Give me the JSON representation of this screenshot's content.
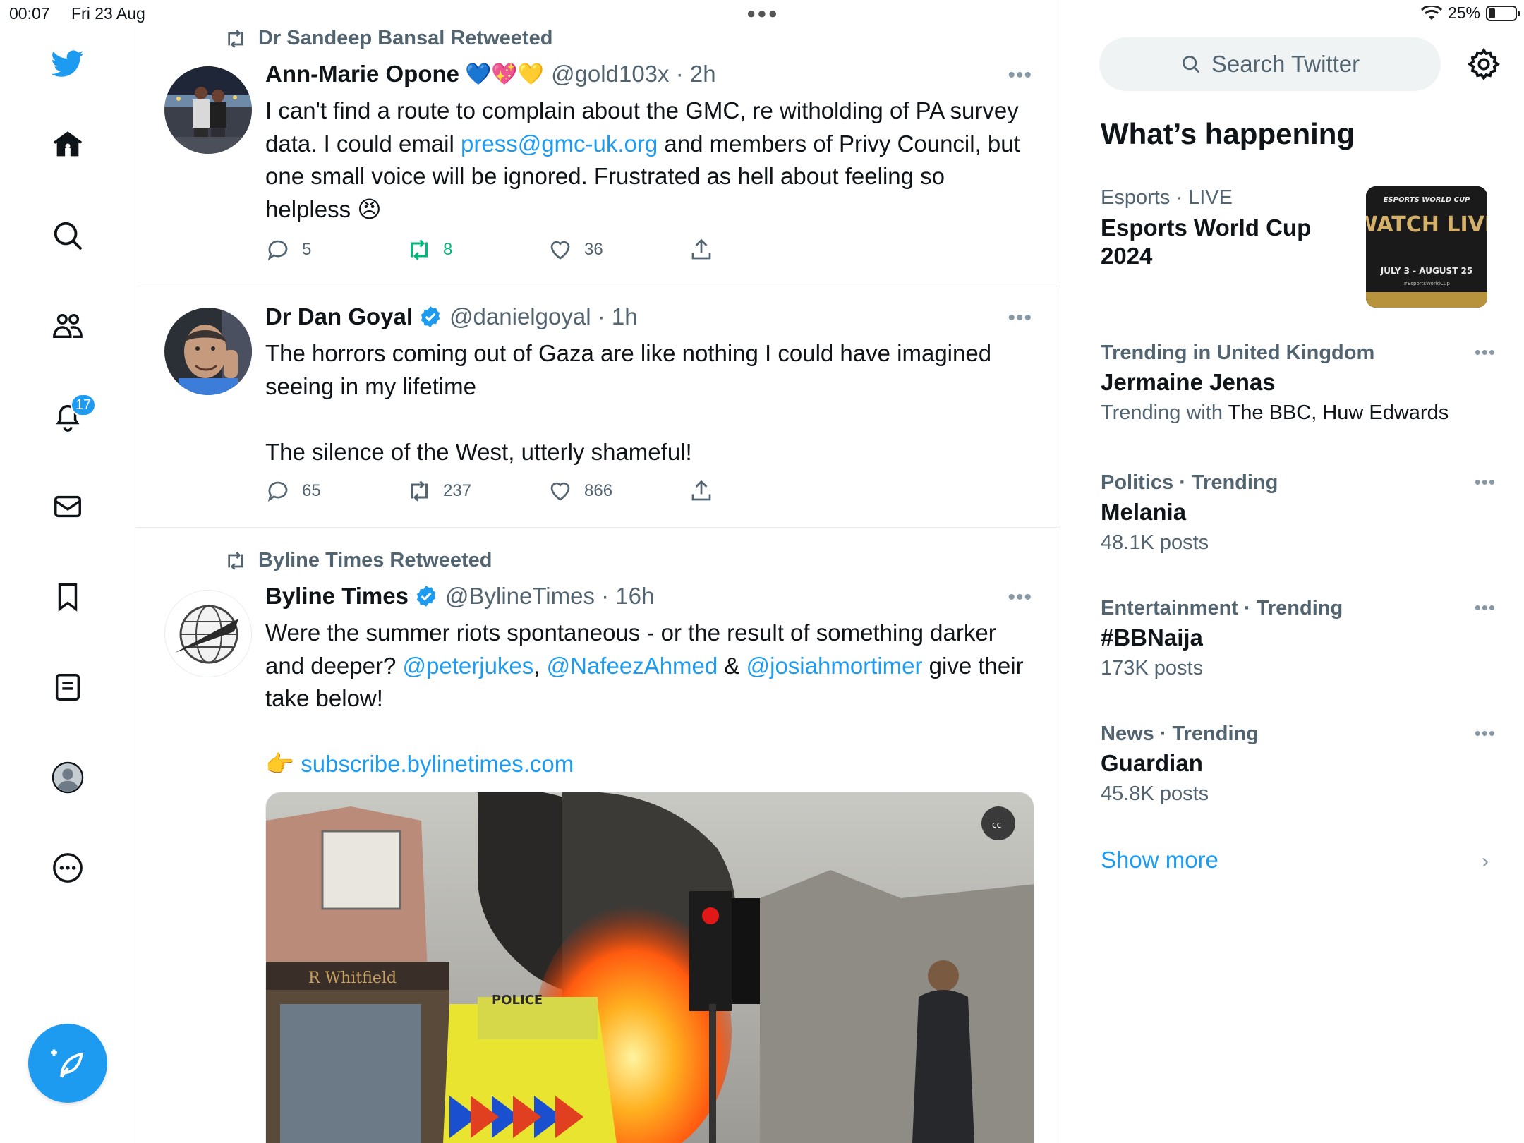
{
  "status_bar": {
    "time": "00:07",
    "date": "Fri 23 Aug",
    "battery": "25%"
  },
  "sidebar": {
    "items": [
      {
        "name": "home"
      },
      {
        "name": "explore"
      },
      {
        "name": "communities"
      },
      {
        "name": "notifications",
        "badge": "17"
      },
      {
        "name": "messages"
      },
      {
        "name": "bookmarks"
      },
      {
        "name": "lists"
      },
      {
        "name": "profile"
      },
      {
        "name": "more"
      }
    ]
  },
  "feed": {
    "tweets": [
      {
        "retweeted_by": "Dr Sandeep Bansal Retweeted",
        "name": "Ann-Marie Opone",
        "emojis": "💙💖💛",
        "handle": "@gold103x · 2h",
        "text_1": "I can't find a route to complain about the GMC, re witholding of PA survey data.  I could email ",
        "link_1": "press@gmc-uk.org",
        "text_2": " and members of Privy Council, but one small voice will be ignored. Frustrated as hell about feeling so helpless ",
        "emoji_end": "😠",
        "replies": "5",
        "retweets": "8",
        "likes": "36"
      },
      {
        "name": "Dr Dan Goyal",
        "handle": "@danielgoyal · 1h",
        "text_1": "The horrors coming out of Gaza are like nothing I could have imagined seeing in my lifetime",
        "text_2": "The silence of the West, utterly shameful!",
        "replies": "65",
        "retweets": "237",
        "likes": "866"
      },
      {
        "retweeted_by": "Byline Times Retweeted",
        "name": "Byline Times",
        "handle": "@BylineTimes · 16h",
        "text_1": "Were the summer riots spontaneous - or the result of something darker and deeper? ",
        "mention_1": "@peterjukes",
        "sep_1": ", ",
        "mention_2": "@NafeezAhmed",
        "sep_2": " & ",
        "mention_3": "@josiahmortimer",
        "text_2": " give their take below!",
        "pointer": "👉",
        "link": "subscribe.bylinetimes.com",
        "media_caption_badge": "cc",
        "police_text": "POLICE",
        "shop_text": "R Whitfield"
      }
    ]
  },
  "right": {
    "search_placeholder": "Search Twitter",
    "section_title": "What’s happening",
    "trends": [
      {
        "category": "Esports",
        "live": "LIVE",
        "title": "Esports World Cup 2024",
        "thumb": {
          "top": "ESPORTS WORLD CUP",
          "main": "WATCH LIVE",
          "dates": "JULY 3 - AUGUST 25",
          "tag": "#EsportsWorldCup"
        }
      },
      {
        "category": "Trending in United Kingdom",
        "title": "Jermaine Jenas",
        "sub_prefix": "Trending with ",
        "sub_with": "The BBC, Huw Edwards"
      },
      {
        "category": "Politics · Trending",
        "title": "Melania",
        "sub": "48.1K posts"
      },
      {
        "category": "Entertainment · Trending",
        "title": "#BBNaija",
        "sub": "173K posts"
      },
      {
        "category": "News · Trending",
        "title": "Guardian",
        "sub": "45.8K posts"
      }
    ],
    "show_more": "Show more"
  },
  "colors": {
    "accent": "#1d9bf0",
    "retweet_active": "#00ba7c",
    "muted": "#536471"
  }
}
